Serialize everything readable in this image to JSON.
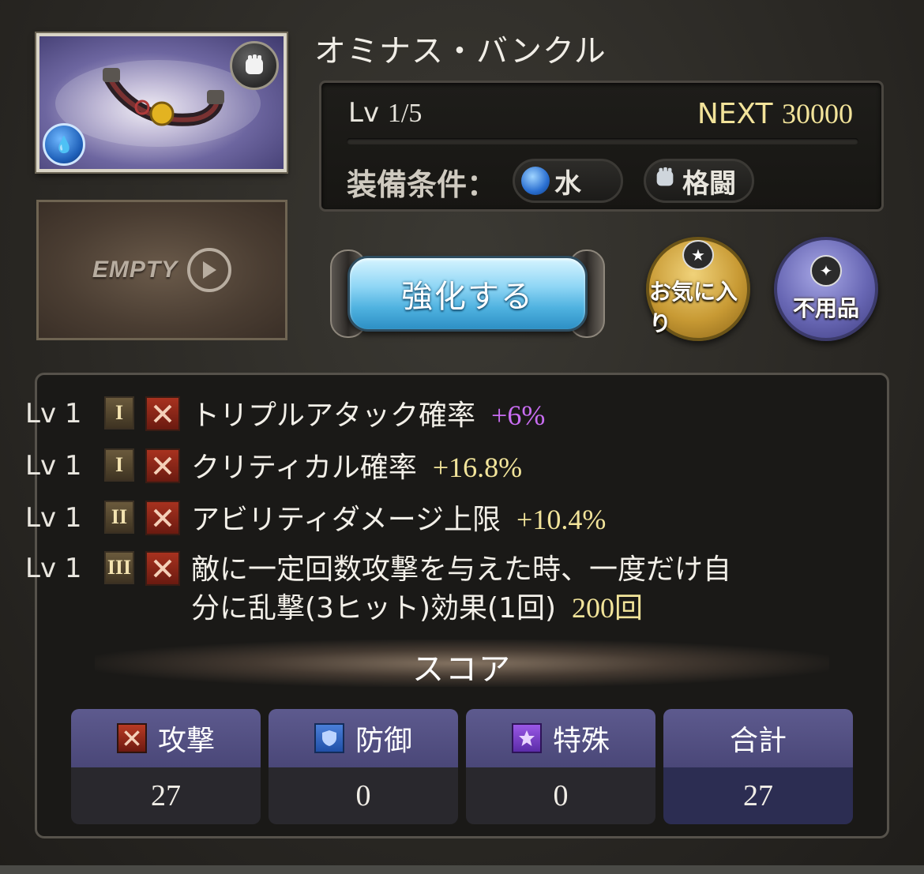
{
  "item": {
    "name": "オミナス・バンクル",
    "element_icon": "water-drops-icon",
    "type_icon": "fist-icon"
  },
  "empty_slot": {
    "label": "EMPTY"
  },
  "info": {
    "level_label": "Lv",
    "level_value": "1/5",
    "next_label": "NEXT",
    "next_value": "30000",
    "equip_label": "装備条件：",
    "equip_conditions": [
      {
        "label": "水",
        "icon": "water-orb-icon"
      },
      {
        "label": "格闘",
        "icon": "fist-icon"
      }
    ]
  },
  "actions": {
    "upgrade_label": "強化する",
    "favorite_label": "お気に入り",
    "unneeded_label": "不用品"
  },
  "skills": [
    {
      "lv": "Lv 1",
      "rank": "I",
      "name": "トリプルアタック確率",
      "value": "+6%",
      "value_color": "#c96df2"
    },
    {
      "lv": "Lv 1",
      "rank": "I",
      "name": "クリティカル確率",
      "value": "+16.8%",
      "value_color": "#f2e49a"
    },
    {
      "lv": "Lv 1",
      "rank": "II",
      "name": "アビリティダメージ上限",
      "value": "+10.4%",
      "value_color": "#f2e49a"
    },
    {
      "lv": "Lv 1",
      "rank": "III",
      "name_line1": "敵に一定回数攻撃を与えた時、一度だけ自",
      "name_line2": "分に乱撃(3ヒット)効果(1回)",
      "value": "200回",
      "value_color": "#f2e49a"
    }
  ],
  "score": {
    "title": "スコア",
    "columns": [
      {
        "label": "攻撃",
        "value": "27",
        "icon": "attack-icon"
      },
      {
        "label": "防御",
        "value": "0",
        "icon": "shield-icon"
      },
      {
        "label": "特殊",
        "value": "0",
        "icon": "star-icon"
      },
      {
        "label": "合計",
        "value": "27"
      }
    ]
  }
}
